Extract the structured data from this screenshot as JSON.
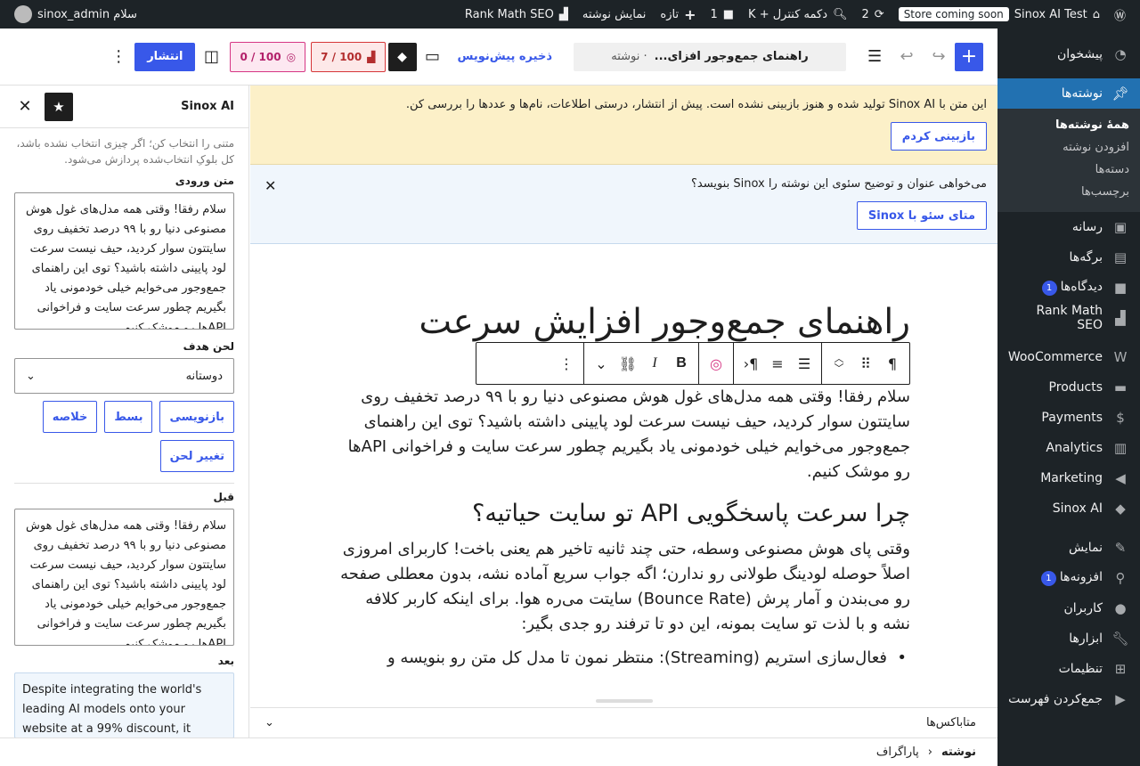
{
  "adminbar": {
    "site_name": "Sinox AI Test",
    "store_badge": "Store coming soon",
    "updates_count": "2",
    "search_label": "دکمه کنترل + K",
    "comments_count": "1",
    "new_label": "تازه",
    "view_post": "نمایش نوشته",
    "rankmath": "Rank Math SEO",
    "greeting": "سلام sinox_admin"
  },
  "menu": {
    "dashboard": "پیشخوان",
    "posts": "نوشته‌ها",
    "posts_sub": [
      "همهٔ نوشته‌ها",
      "افزودن نوشته",
      "دسته‌ها",
      "برچسب‌ها"
    ],
    "media": "رسانه",
    "pages": "برگه‌ها",
    "comments": "دیدگاه‌ها",
    "comments_count": "1",
    "rankmath": "Rank Math SEO",
    "woocommerce": "WooCommerce",
    "products": "Products",
    "payments": "Payments",
    "analytics": "Analytics",
    "marketing": "Marketing",
    "sinox": "Sinox AI",
    "appearance": "نمایش",
    "plugins": "افزونه‌ها",
    "plugins_count": "1",
    "users": "کاربران",
    "tools": "ابزارها",
    "settings": "تنظیمات",
    "collapse": "جمع‌کردن فهرست"
  },
  "header": {
    "doc_title": "راهنمای جمع‌وجور افزای...",
    "doc_type": "· نوشته",
    "save_draft": "ذخیره پیش‌نویس",
    "seo_score": "100 / 7",
    "ai_score": "100 / 0",
    "publish": "انتشار"
  },
  "notices": {
    "review_msg": "این متن با Sinox AI تولید شده و هنوز بازبینی نشده است. پیش از انتشار، درستی اطلاعات، نام‌ها و عددها را بررسی کن.",
    "review_btn": "بازبینی کردم",
    "seo_msg": "می‌خواهی عنوان و توضیح سئوی این نوشته را Sinox بنویسد؟",
    "seo_btn": "متای سئو با Sinox"
  },
  "post": {
    "title": "راهنمای جمع‌وجور افزایش سرعت",
    "para1": "سلام رفقا! وقتی همه مدل‌های غول هوش مصنوعی دنیا رو با ۹۹ درصد تخفیف روی سایتتون سوار کردید، حیف نیست سرعت لود پایینی داشته باشید؟ توی این راهنمای جمع‌وجور می‌خوایم خیلی خودمونی یاد بگیریم چطور سرعت سایت و فراخوانی APIها رو موشک کنیم.",
    "h2": "چرا سرعت پاسخگویی API تو سایت حیاتیه؟",
    "para2": "وقتی پای هوش مصنوعی وسطه، حتی چند ثانیه تاخیر هم یعنی باخت! کاربرای امروزی اصلاً حوصله لودینگ طولانی رو ندارن؛ اگه جواب سریع آماده نشه، بدون معطلی صفحه رو می‌بندن و آمار پرش (Bounce Rate) سایتت می‌ره هوا. برای اینکه کاربر کلافه نشه و با لذت تو سایت بمونه، این دو تا ترفند رو جدی بگیر:",
    "li1": "فعال‌سازی استریم (Streaming): منتظر نمون تا مدل کل متن رو بنویسه و"
  },
  "metabox": {
    "label": "متاباکس‌ها"
  },
  "footer": {
    "crumb1": "نوشته",
    "crumb2": "پاراگراف"
  },
  "sidebar": {
    "title": "Sinox AI",
    "hint": "متنی را انتخاب کن؛ اگر چیزی انتخاب نشده باشد، کل بلوکِ انتخاب‌شده پردازش می‌شود.",
    "input_label": "متن ورودی",
    "input_text": "سلام رفقا! وقتی همه مدل‌های غول هوش مصنوعی دنیا رو با ۹۹ درصد تخفیف روی سایتتون سوار کردید، حیف نیست سرعت لود پایینی داشته باشید؟ توی این راهنمای جمع‌وجور می‌خوایم خیلی خودمونی یاد بگیریم چطور سرعت سایت و فراخوانی APIها رو موشک کنیم.",
    "tone_label": "لحن هدف",
    "tone_value": "دوستانه",
    "btn_rewrite": "بازنویسی",
    "btn_expand": "بسط",
    "btn_summary": "خلاصه",
    "btn_tone": "تغییر لحن",
    "before_label": "قبل",
    "before_text": "سلام رفقا! وقتی همه مدل‌های غول هوش مصنوعی دنیا رو با ۹۹ درصد تخفیف روی سایتتون سوار کردید، حیف نیست سرعت لود پایینی داشته باشید؟ توی این راهنمای جمع‌وجور می‌خوایم خیلی خودمونی یاد بگیریم چطور سرعت سایت و فراخوانی APIها رو موشک کنیم.",
    "after_label": "بعد",
    "after_text": "Despite integrating the world's leading AI models onto your website at a 99% discount, it would be a shame..."
  },
  "icons": {
    "wp": "wordpress-icon",
    "add": "plus-icon",
    "list": "list-view-icon",
    "undo": "undo-icon",
    "redo": "redo-icon"
  },
  "colors": {
    "accent": "#3858e9",
    "adminbar": "#1d2327",
    "notice_yellow": "#fcf0c8",
    "notice_blue": "#f0f6fc"
  }
}
